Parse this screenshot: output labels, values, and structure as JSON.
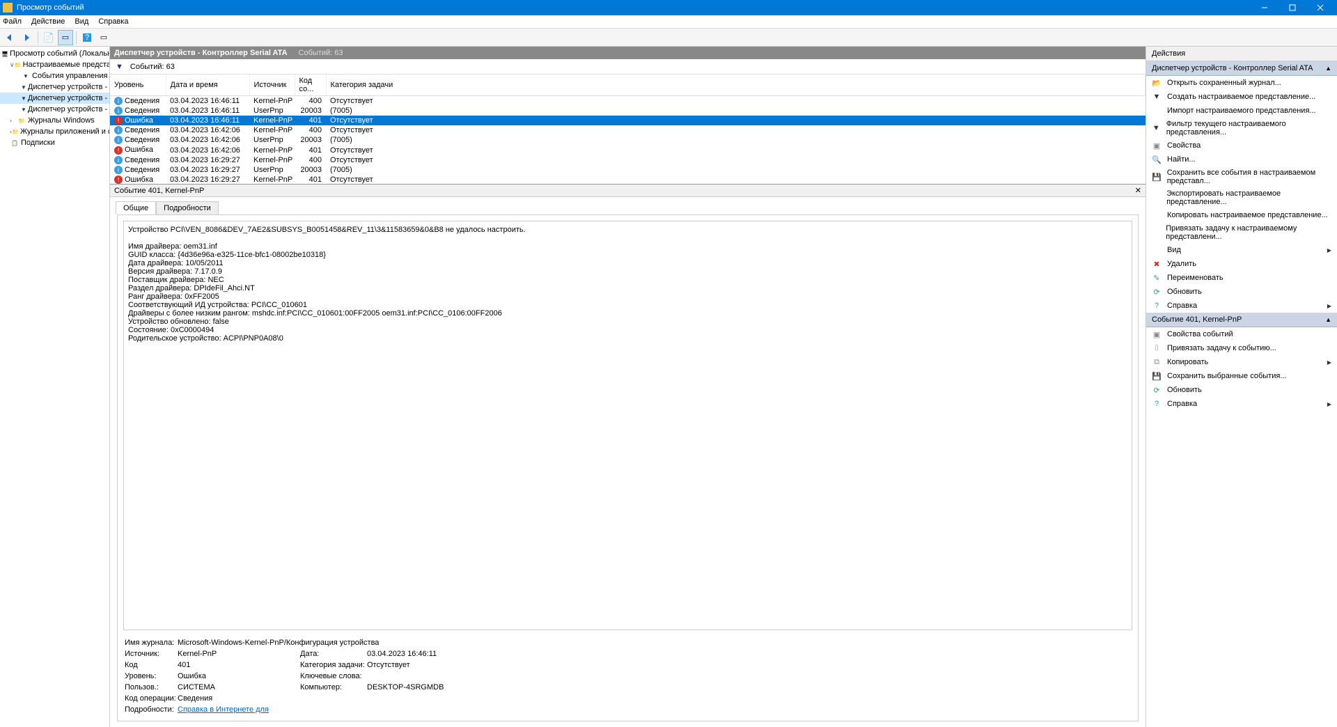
{
  "window": {
    "title": "Просмотр событий"
  },
  "menu": {
    "file": "Файл",
    "action": "Действие",
    "view": "Вид",
    "help": "Справка"
  },
  "tree": {
    "root": "Просмотр событий (Локальны",
    "custom_views": "Настраиваемые представле",
    "admin_events": "События управления",
    "dm1": "Диспетчер устройств - Н",
    "dm2": "Диспетчер устройств - К",
    "dm3": "Диспетчер устройств - Н",
    "winlogs": "Журналы Windows",
    "applogs": "Журналы приложений и сл",
    "subs": "Подписки"
  },
  "center": {
    "title": "Диспетчер устройств - Контроллер Serial ATA",
    "count_label": "Событий: 63",
    "filter_count": "Событий: 63"
  },
  "columns": {
    "level": "Уровень",
    "date": "Дата и время",
    "source": "Источник",
    "code": "Код со...",
    "task": "Категория задачи"
  },
  "level": {
    "info": "Сведения",
    "error": "Ошибка"
  },
  "rows": [
    {
      "lv": "info",
      "date": "03.04.2023 16:46:11",
      "src": "Kernel-PnP",
      "code": "400",
      "task": "Отсутствует"
    },
    {
      "lv": "info",
      "date": "03.04.2023 16:46:11",
      "src": "UserPnp",
      "code": "20003",
      "task": "(7005)"
    },
    {
      "lv": "error",
      "date": "03.04.2023 16:46:11",
      "src": "Kernel-PnP",
      "code": "401",
      "task": "Отсутствует",
      "sel": true
    },
    {
      "lv": "info",
      "date": "03.04.2023 16:42:06",
      "src": "Kernel-PnP",
      "code": "400",
      "task": "Отсутствует"
    },
    {
      "lv": "info",
      "date": "03.04.2023 16:42:06",
      "src": "UserPnp",
      "code": "20003",
      "task": "(7005)"
    },
    {
      "lv": "error",
      "date": "03.04.2023 16:42:06",
      "src": "Kernel-PnP",
      "code": "401",
      "task": "Отсутствует"
    },
    {
      "lv": "info",
      "date": "03.04.2023 16:29:27",
      "src": "Kernel-PnP",
      "code": "400",
      "task": "Отсутствует"
    },
    {
      "lv": "info",
      "date": "03.04.2023 16:29:27",
      "src": "UserPnp",
      "code": "20003",
      "task": "(7005)"
    },
    {
      "lv": "error",
      "date": "03.04.2023 16:29:27",
      "src": "Kernel-PnP",
      "code": "401",
      "task": "Отсутствует"
    }
  ],
  "detail_header": "Событие 401, Kernel-PnP",
  "tabs": {
    "general": "Общие",
    "details": "Подробности"
  },
  "message": "Устройство PCI\\VEN_8086&DEV_7AE2&SUBSYS_B0051458&REV_11\\3&11583659&0&B8 не удалось настроить.\n\nИмя драйвера: oem31.inf\nGUID класса: {4d36e96a-e325-11ce-bfc1-08002be10318}\nДата драйвера: 10/05/2011\nВерсия драйвера: 7.17.0.9\nПоставщик драйвера: NEC\nРаздел драйвера: DPIdeFil_Ahci.NT\nРанг драйвера: 0xFF2005\nСоответствующий ИД устройства: PCI\\CC_010601\nДрайверы с более низким рангом: mshdc.inf:PCI\\CC_010601:00FF2005 oem31.inf:PCI\\CC_0106:00FF2006\nУстройство обновлено: false\nСостояние: 0xC0000494\nРодительское устройство: ACPI\\PNP0A08\\0",
  "meta": {
    "log_lbl": "Имя журнала:",
    "log_val": "Microsoft-Windows-Kernel-PnP/Конфигурация устройства",
    "src_lbl": "Источник:",
    "src_val": "Kernel-PnP",
    "date_lbl": "Дата:",
    "date_val": "03.04.2023 16:46:11",
    "code_lbl": "Код",
    "code_val": "401",
    "task_lbl": "Категория задачи:",
    "task_val": "Отсутствует",
    "lvl_lbl": "Уровень:",
    "lvl_val": "Ошибка",
    "kw_lbl": "Ключевые слова:",
    "kw_val": "",
    "user_lbl": "Пользов.:",
    "user_val": "СИСТЕМА",
    "comp_lbl": "Компьютер:",
    "comp_val": "DESKTOP-4SRGMDB",
    "op_lbl": "Код операции:",
    "op_val": "Сведения",
    "more_lbl": "Подробности:",
    "more_link": "Справка в Интернете для"
  },
  "actions": {
    "header": "Действия",
    "section1": "Диспетчер устройств - Контроллер Serial ATA",
    "open": "Открыть сохраненный журнал...",
    "create": "Создать настраиваемое представление...",
    "import": "Импорт настраиваемого представления...",
    "filter": "Фильтр текущего настраиваемого представления...",
    "props": "Свойства",
    "find": "Найти...",
    "saveall": "Сохранить все события в настраиваемом представл...",
    "export": "Экспортировать настраиваемое представление...",
    "copyview": "Копировать настраиваемое представление...",
    "attach": "Привязать задачу к настраиваемому представлени...",
    "view": "Вид",
    "delete": "Удалить",
    "rename": "Переименовать",
    "refresh": "Обновить",
    "help": "Справка",
    "section2": "Событие 401, Kernel-PnP",
    "evprops": "Свойства событий",
    "evattach": "Привязать задачу к событию...",
    "evcopy": "Копировать",
    "evsave": "Сохранить выбранные события...",
    "evrefresh": "Обновить",
    "evhelp": "Справка"
  }
}
